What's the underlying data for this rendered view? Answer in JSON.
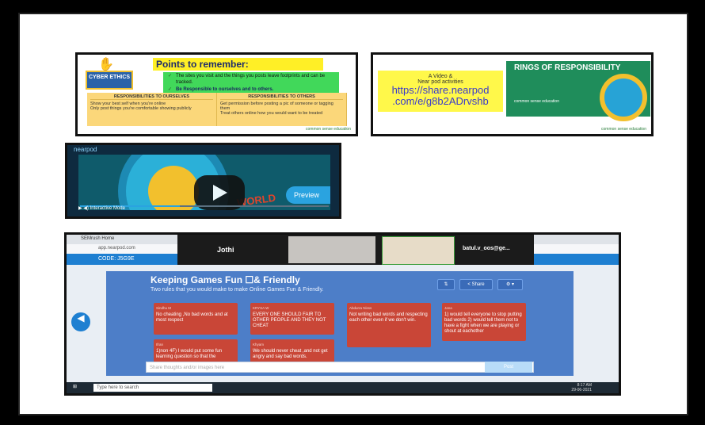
{
  "slide1": {
    "title": "Points to remember:",
    "cyber_label": "CYBER ETHICS",
    "bullet1": "The sites you visit and the things you posts leave footprints and can be tracked.",
    "bullet2": "Be Responsible to ourselves and to others.",
    "col1_head": "RESPONSIBILITIES TO OURSELVES",
    "col1_items": [
      "Show your best self when you're online",
      "Only post things you're comfortable showing publicly"
    ],
    "col2_head": "RESPONSIBILITIES TO OTHERS",
    "col2_items": [
      "Get permission before posting a pic of someone or tagging them",
      "Treat others online how you would want to be treated"
    ],
    "footer": "common sense education"
  },
  "slide2": {
    "line1": "A Video &",
    "line2": "Near pod activities",
    "link1": "https://share.nearpod",
    "link2": ".com/e/g8b2ADrvshb",
    "green_title": "RINGS OF RESPONSIBILITY",
    "cs_label": "common sense education",
    "footer": "common sense education"
  },
  "video": {
    "logo": "nearpod",
    "preview_label": "Preview",
    "world_text": "WORLD",
    "interactive": "Interactive Mode"
  },
  "screen": {
    "tab_label": "SEMrush Home",
    "url": "app.nearpod.com",
    "code": "CODE: J5G9E",
    "participant1": "Jothi",
    "participant2": "batul.v_oos@ge...",
    "board_title": "Keeping Games Fun ☐& Friendly",
    "board_sub": "Two rules that you would make to make Online Games Fun & Friendly.",
    "share_label": "< Share",
    "cards": [
      {
        "author": "Sindhu M",
        "text": "No cheating ,No bad words and at most respect"
      },
      {
        "author": "KRYSA W",
        "text": "EVERY ONE SHOULD FAIR TO OTHER PEOPLE AND THEY NOT CHEAT"
      },
      {
        "author": "Abdurra Nisss",
        "text": "Not writing bad words and respecting each other even if we don't win."
      },
      {
        "author": "Jana",
        "text": "1) would tell everyone to stop putting bad words 2) would tell them not to have a fight when we are playing or shout at eachother"
      },
      {
        "author": "Ifran",
        "text": "1)non 4F) I would put some fun learning question so that the"
      },
      {
        "author": "Khyam",
        "text": "We should never cheat ,and not get angry and say bad words."
      }
    ],
    "input_placeholder": "Share thoughts and/or images here",
    "post_label": "Post",
    "taskbar_search": "Type here to search",
    "time": "8:17 AM",
    "date": "29-06-2021"
  }
}
